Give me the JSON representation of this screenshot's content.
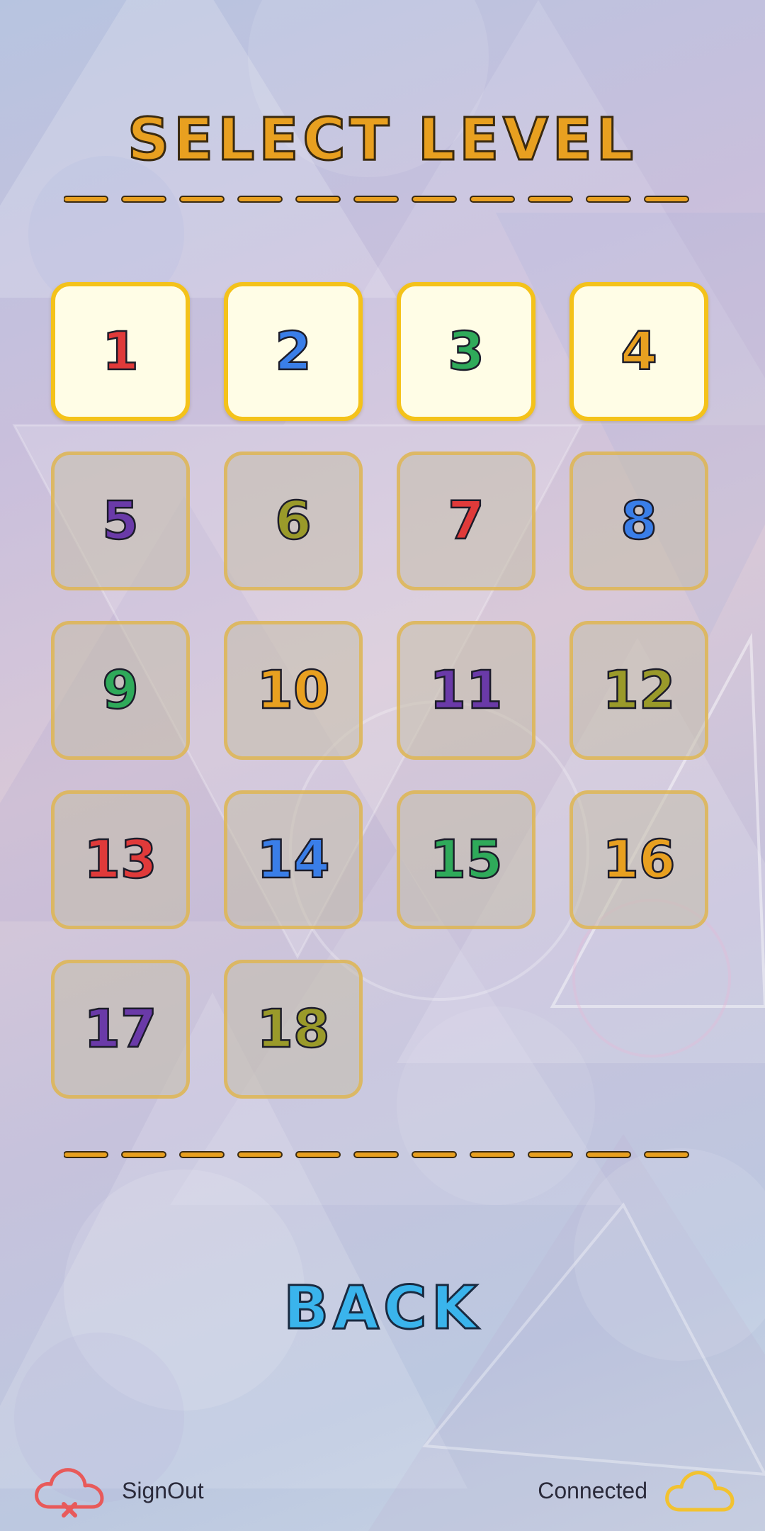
{
  "title": "SELECT LEVEL",
  "levels": [
    {
      "label": "1",
      "color": "#e03a3a",
      "unlocked": true
    },
    {
      "label": "2",
      "color": "#3a7ee8",
      "unlocked": true
    },
    {
      "label": "3",
      "color": "#2faa5a",
      "unlocked": true
    },
    {
      "label": "4",
      "color": "#e8a020",
      "unlocked": true
    },
    {
      "label": "5",
      "color": "#6a3aa8",
      "unlocked": false
    },
    {
      "label": "6",
      "color": "#9a9a2a",
      "unlocked": false
    },
    {
      "label": "7",
      "color": "#e03a3a",
      "unlocked": false
    },
    {
      "label": "8",
      "color": "#3a7ee8",
      "unlocked": false
    },
    {
      "label": "9",
      "color": "#2faa5a",
      "unlocked": false
    },
    {
      "label": "10",
      "color": "#e8a020",
      "unlocked": false
    },
    {
      "label": "11",
      "color": "#6a3aa8",
      "unlocked": false
    },
    {
      "label": "12",
      "color": "#9a9a2a",
      "unlocked": false
    },
    {
      "label": "13",
      "color": "#e03a3a",
      "unlocked": false
    },
    {
      "label": "14",
      "color": "#3a7ee8",
      "unlocked": false
    },
    {
      "label": "15",
      "color": "#2faa5a",
      "unlocked": false
    },
    {
      "label": "16",
      "color": "#e8a020",
      "unlocked": false
    },
    {
      "label": "17",
      "color": "#6a3aa8",
      "unlocked": false
    },
    {
      "label": "18",
      "color": "#9a9a2a",
      "unlocked": false
    }
  ],
  "back_label": "BACK",
  "footer": {
    "signout_label": "SignOut",
    "signout_icon": "cloud-off-icon",
    "signout_color": "#e85a5a",
    "connected_label": "Connected",
    "connected_icon": "cloud-icon",
    "connected_color": "#f2c230"
  },
  "colors": {
    "title": "#e8a020",
    "divider": "#e8a020",
    "back": "#3ab4ec",
    "tile_border": "#f4c21a"
  }
}
